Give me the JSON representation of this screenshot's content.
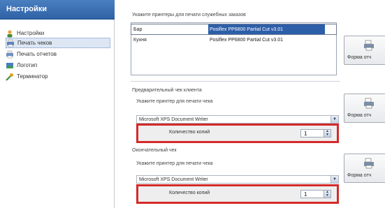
{
  "sidebar": {
    "title": "Настройки",
    "items": [
      {
        "label": "Настройки",
        "icon": "settings-person-icon"
      },
      {
        "label": "Печать чеков",
        "icon": "receipt-print-icon",
        "selected": true
      },
      {
        "label": "Печать отчетов",
        "icon": "report-print-icon"
      },
      {
        "label": "Логотип",
        "icon": "logo-image-icon"
      },
      {
        "label": "Терминатор",
        "icon": "terminator-icon"
      }
    ]
  },
  "service": {
    "label": "Укажите принтеры для печати служебных заказов",
    "printers": [
      {
        "name": "Бар",
        "printer": "Posiflex PP6800 Partial Cut v3.01"
      },
      {
        "name": "Кухня",
        "printer": "Posiflex PP6800 Partial Cut v3.01"
      }
    ],
    "form_button": "Форма отч"
  },
  "prelim": {
    "section": "Предварительный чек клиента",
    "label": "Укажите принтер для печати чека",
    "printer": "Microsoft XPS Document Writer",
    "copies_label": "Количество копий",
    "copies": "1",
    "form_button": "Форма отч"
  },
  "final": {
    "section": "Окончательный чек",
    "label": "Укажите принтер для печати чека",
    "printer": "Microsoft XPS Document Writer",
    "copies_label": "Количество копий",
    "copies": "1",
    "form_button": "Форма отч"
  }
}
